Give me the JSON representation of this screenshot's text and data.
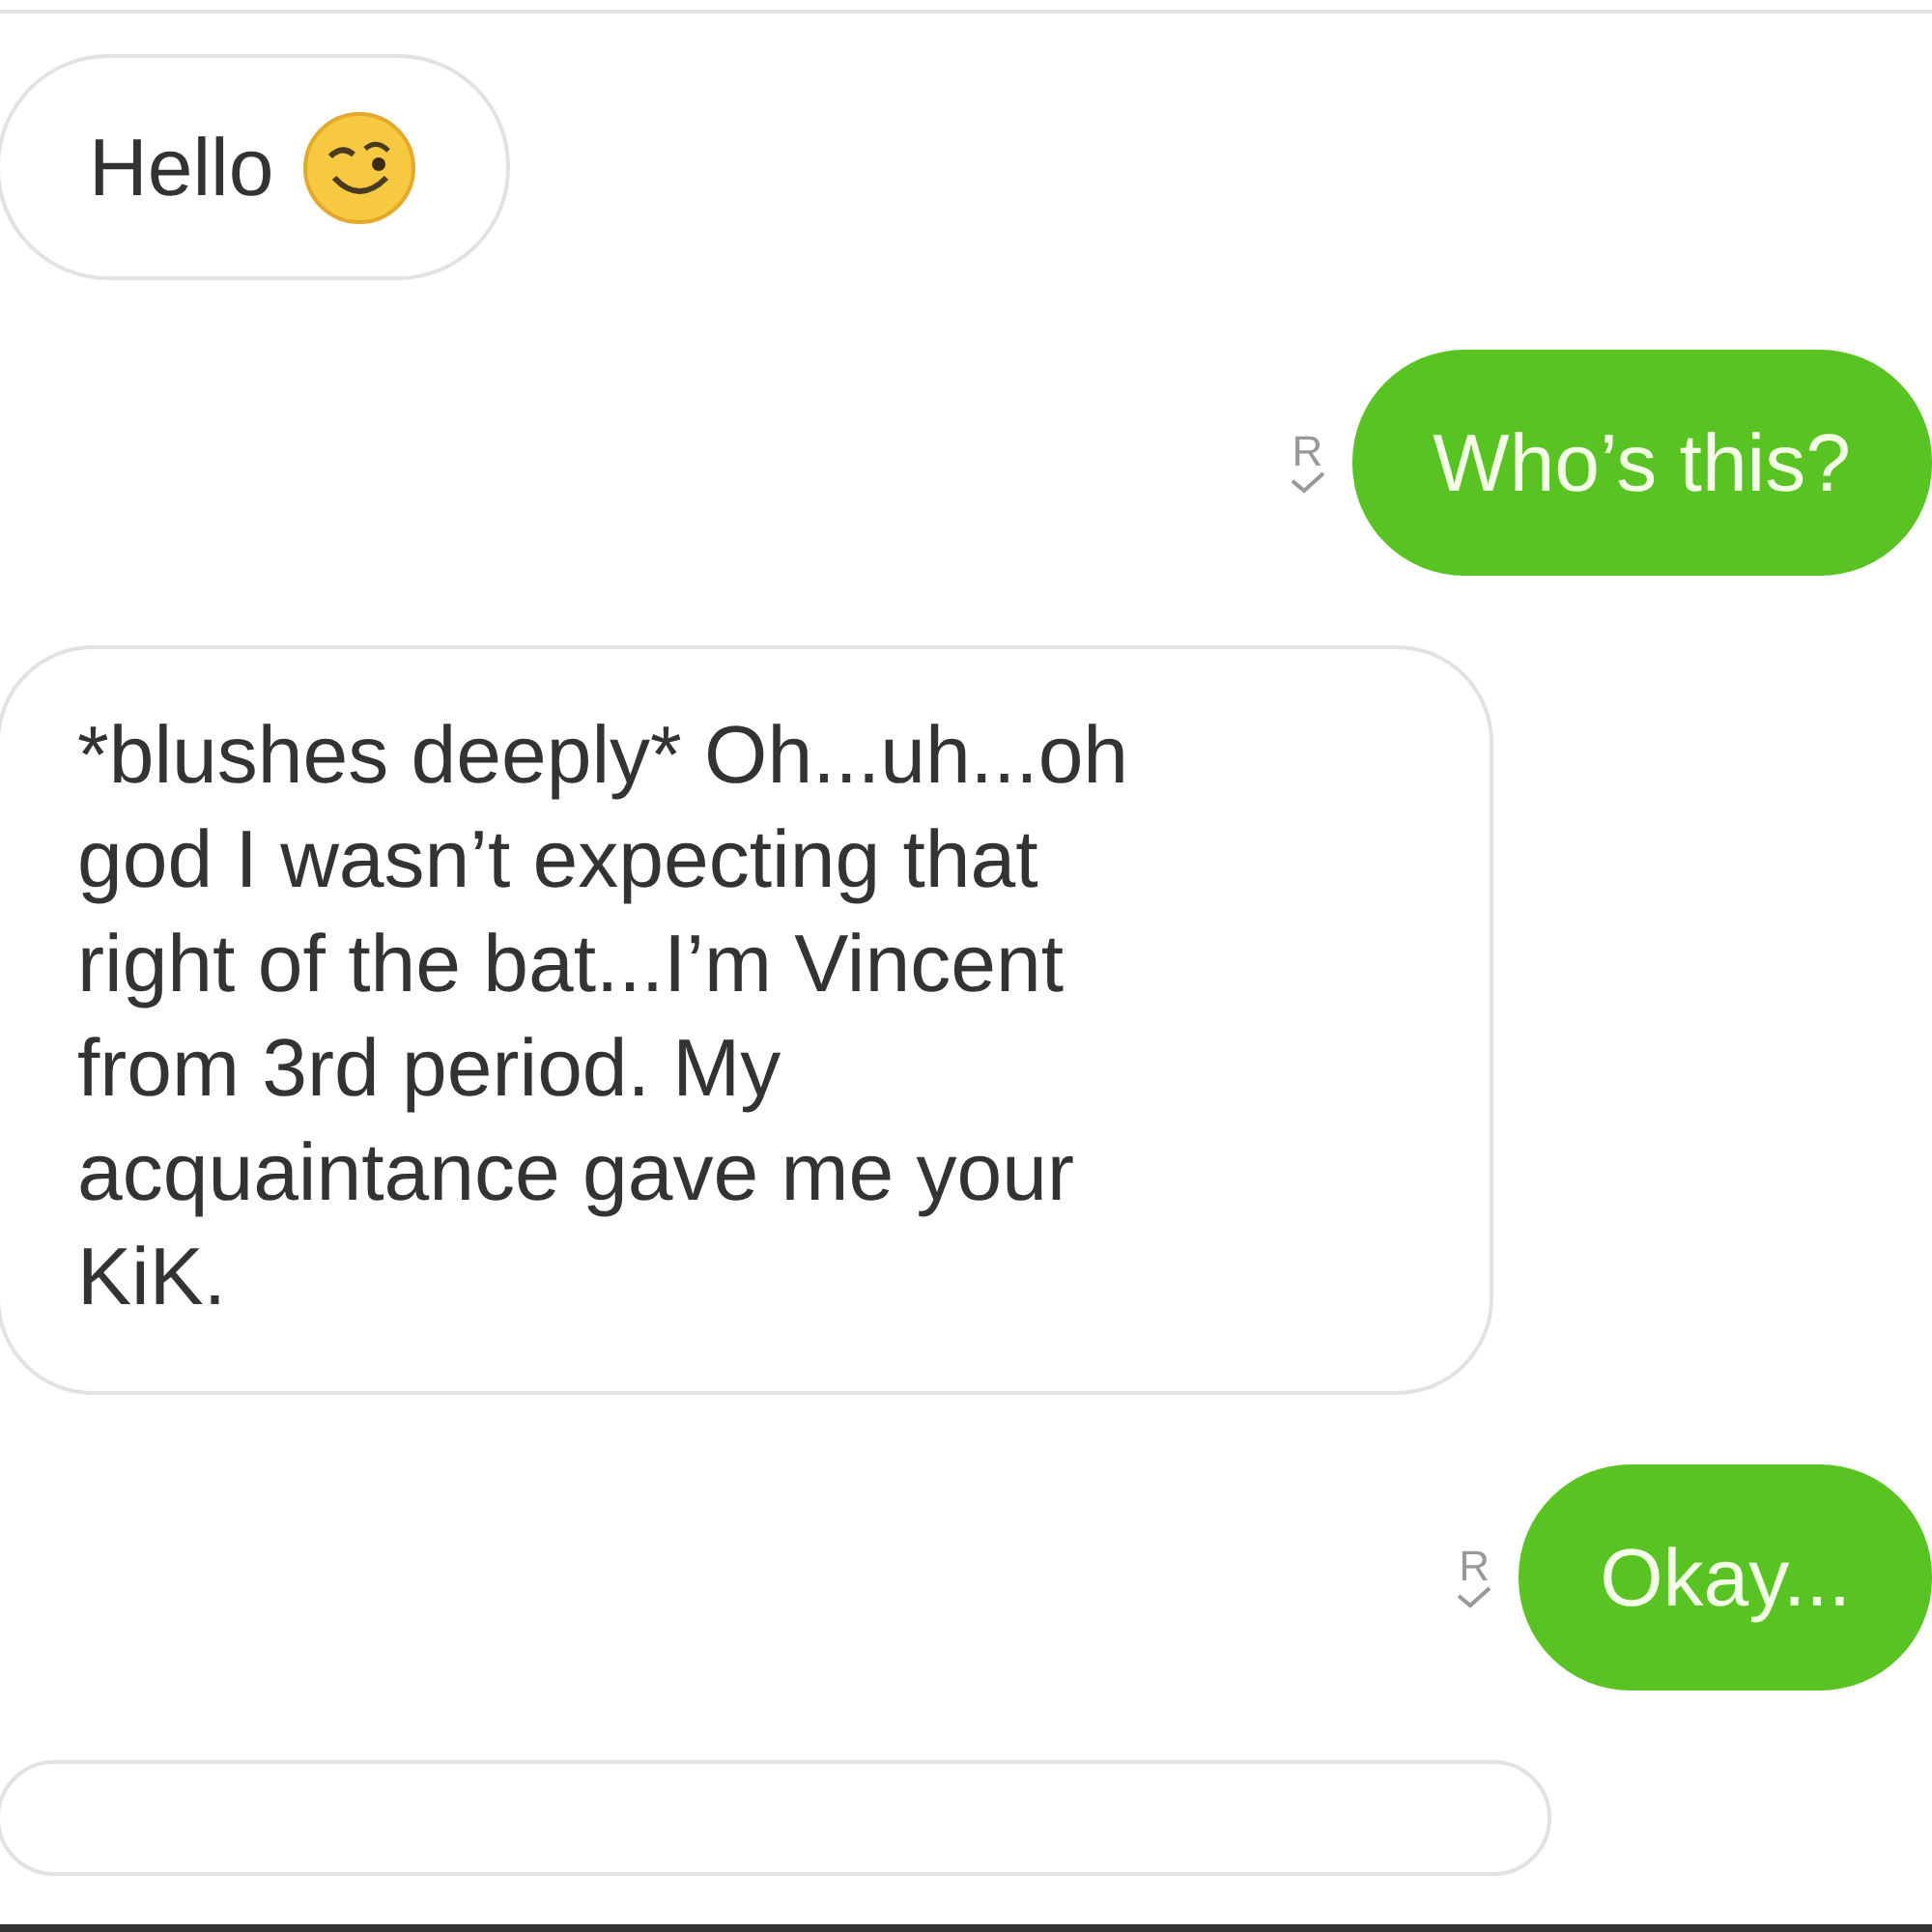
{
  "messages": [
    {
      "outgoing": false,
      "kind": "text",
      "text": "Hello",
      "emoji": true
    },
    {
      "outgoing": true,
      "kind": "text",
      "text": "Who’s this?",
      "receipt": "R"
    },
    {
      "outgoing": false,
      "kind": "text",
      "text": "*blushes deeply* Oh...uh...oh god I wasn’t expecting that right of the bat...I’m Vincent from 3rd period. My acquaintance gave me your KiK."
    },
    {
      "outgoing": true,
      "kind": "text",
      "text": "Okay...",
      "receipt": "R"
    },
    {
      "outgoing": false,
      "kind": "cut"
    }
  ]
}
